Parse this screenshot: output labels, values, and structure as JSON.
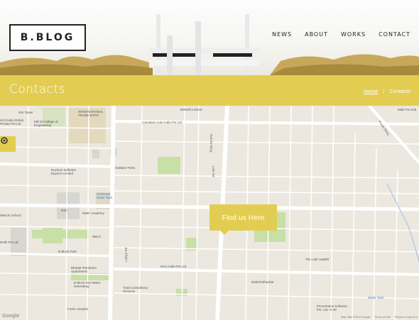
{
  "brand": {
    "logo_text": "B.BLOG"
  },
  "nav": {
    "items": [
      "NEWS",
      "ABOUT",
      "WORKS",
      "CONTACT"
    ]
  },
  "band": {
    "title": "Contacts",
    "breadcrumb": {
      "home": "Home",
      "separator": "/",
      "current": "Contacts"
    }
  },
  "map": {
    "marker_label": "Find us Here",
    "pois": [
      "INS Tower",
      "Bellsoft Limited",
      "Malti Fix Hub",
      "Carnation Auto India Pvt Ltd",
      "INTERNATIONAL TRADE EXPO",
      "MD M College of Engineering",
      "Kirti India Global Private Pvt Ltd",
      "Nucleus Software Exports Limited",
      "Solitaire Parts",
      "OneRoad Water Tank",
      "ESC",
      "NMIF Academy",
      "Mascot School",
      "NBCC",
      "B Block Park",
      "Bharati Petroleum Apartments",
      "B Block Kim Water Harvesting",
      "Delhi Pvt Ltd",
      "Fortis Hospital",
      "Doru India Pvt Ltd",
      "Total Consultancy Services",
      "Daleelt Bhaskar",
      "The Lalit Ladakh",
      "Pinnorhams Software Pvt. Ltd. G-49",
      "Water Tank"
    ],
    "road_labels": [
      "Rail 45 Marg",
      "Link Rd",
      "Lohiya Rd",
      "Purab Marg"
    ],
    "google": "Google",
    "footer": [
      "Map data ©2014 Google",
      "Terms of Use",
      "Report a map error"
    ]
  },
  "colors": {
    "accent": "#e2cd52",
    "map_bg": "#ece8df",
    "park": "#c8dfa5",
    "road": "#ffffff"
  }
}
